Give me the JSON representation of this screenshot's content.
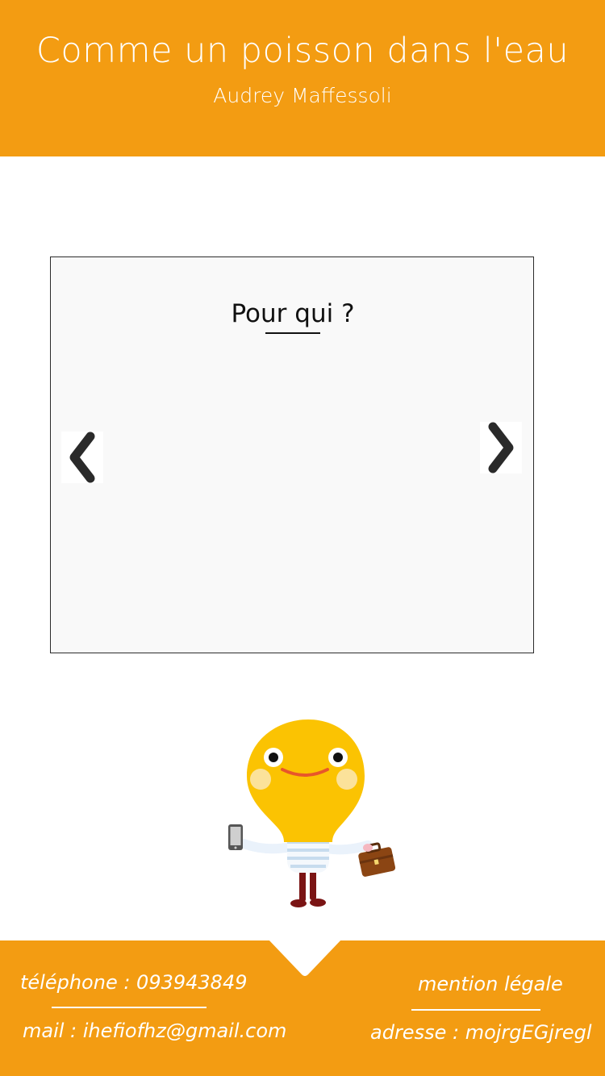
{
  "header": {
    "title": "Comme un poisson dans l'eau",
    "subtitle": "Audrey Maffessoli"
  },
  "carousel": {
    "slide_title": "Pour qui ?",
    "prev_icon": "chevron-left-icon",
    "next_icon": "chevron-right-icon"
  },
  "mascot": {
    "icon": "lightbulb-character-icon"
  },
  "footer": {
    "phone": "téléphone : 093943849",
    "mail": "mail : ihefiofhz@gmail.com",
    "legal": "mention légale",
    "address": "adresse : mojrgEGjregl"
  },
  "colors": {
    "primary_orange": "#f39c12",
    "white": "#ffffff",
    "text_dark": "#111111",
    "arrow_dark": "#2a2a2a"
  }
}
